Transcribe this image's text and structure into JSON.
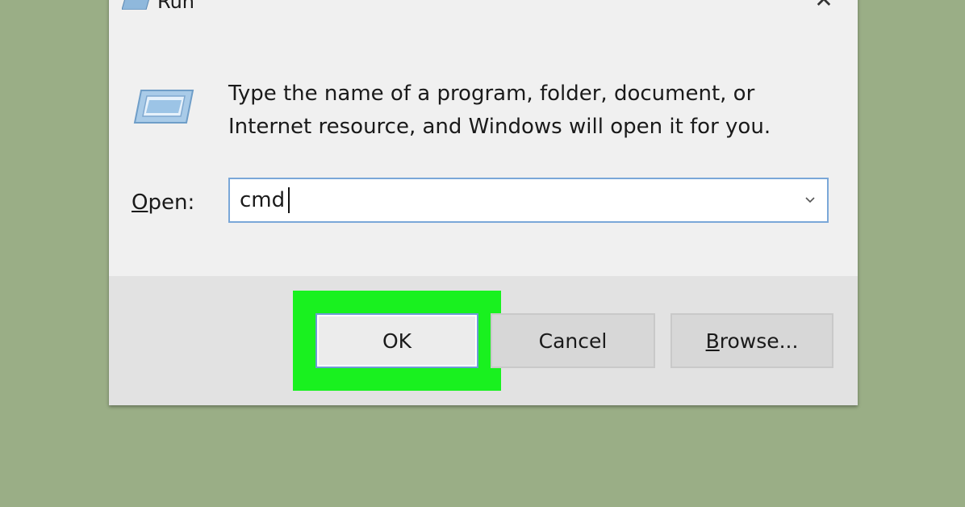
{
  "window": {
    "title": "Run",
    "close_glyph": "✕"
  },
  "icons": {
    "title": "run-program-icon",
    "main": "run-program-icon",
    "dropdown": "chevron-down-icon",
    "close": "close-icon"
  },
  "description": {
    "line1": "Type the name of a program, folder, document, or",
    "line2": "Internet resource, and Windows will open it for you."
  },
  "open_field": {
    "label": "Open:",
    "value": "cmd"
  },
  "buttons": {
    "ok": "OK",
    "cancel": "Cancel",
    "browse": "Browse..."
  },
  "colors": {
    "background": "#9aae86",
    "dialog": "#f0f0f0",
    "footer": "#e2e2e2",
    "highlight": "#19f11f",
    "focus_border": "#7aa7d8"
  }
}
